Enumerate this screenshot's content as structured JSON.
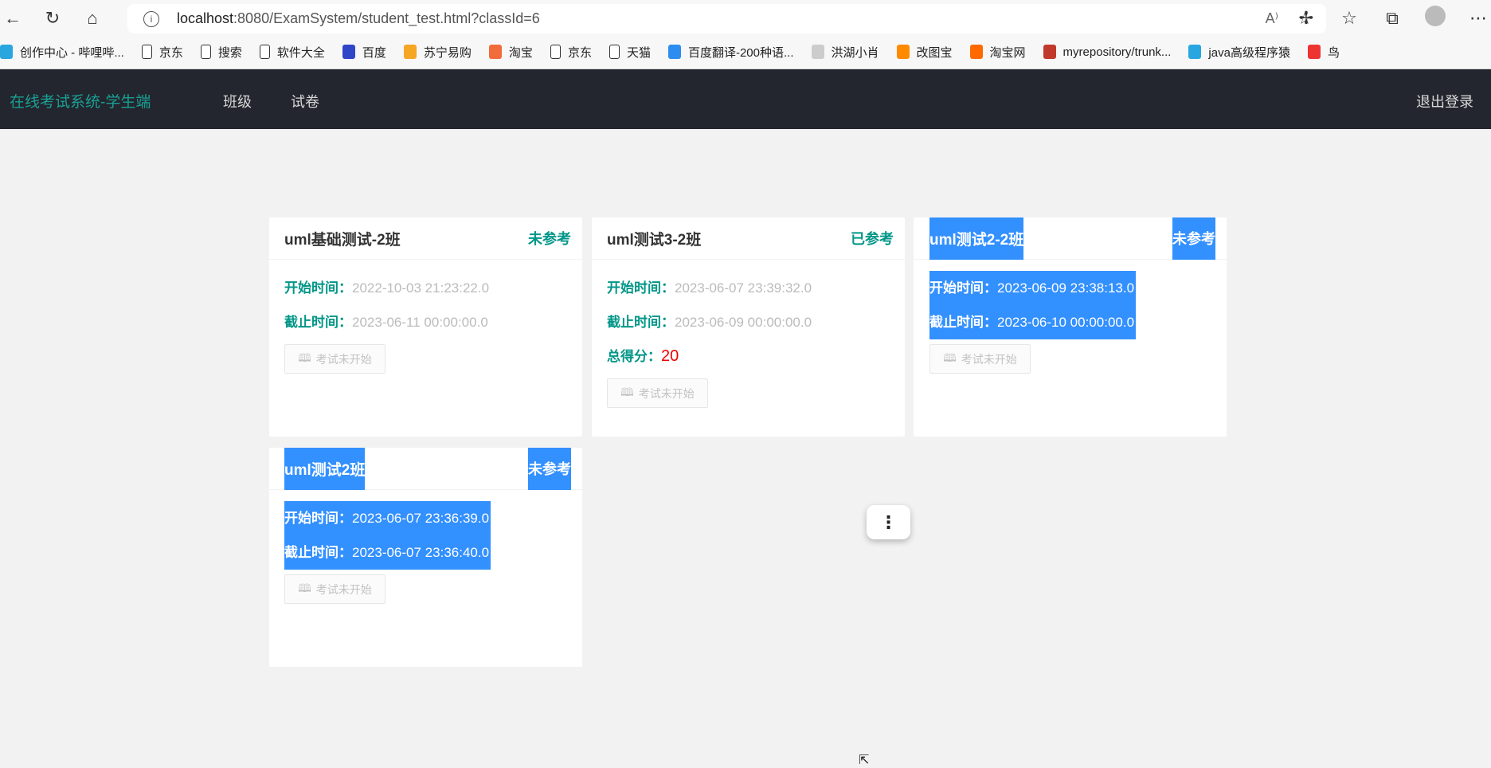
{
  "browser": {
    "url_host": "localhost",
    "url_rest": ":8080/ExamSystem/student_test.html?classId=6",
    "bookmarks": [
      "创作中心 - 哔哩哔...",
      "京东",
      "搜索",
      "软件大全",
      "百度",
      "苏宁易购",
      "淘宝",
      "京东",
      "天猫",
      "百度翻译-200种语...",
      "洪湖小肖",
      "改图宝",
      "淘宝网",
      "myrepository/trunk...",
      "java高级程序猿",
      "鸟"
    ]
  },
  "nav": {
    "brand": "在线考试系统-学生端",
    "items": [
      "班级",
      "试卷"
    ],
    "logout": "退出登录"
  },
  "labels": {
    "start": "开始时间：",
    "end": "截止时间：",
    "score": "总得分：",
    "button": "考试未开始"
  },
  "cards": [
    {
      "title": "uml基础测试-2班",
      "status": "未参考",
      "start": "2022-10-03 21:23:22.0",
      "end": "2023-06-11 00:00:00.0"
    },
    {
      "title": "uml测试3-2班",
      "status": "已参考",
      "start": "2023-06-07 23:39:32.0",
      "end": "2023-06-09 00:00:00.0",
      "score": "20"
    },
    {
      "title": "uml测试2-2班",
      "status": "未参考",
      "start": "2023-06-09 23:38:13.0",
      "end": "2023-06-10 00:00:00.0"
    },
    {
      "title": "uml测试2班",
      "status": "未参考",
      "start": "2023-06-07 23:36:39.0",
      "end": "2023-06-07 23:36:40.0"
    }
  ],
  "colors": {
    "accent": "#009688",
    "nav_bg": "#23262e",
    "selection": "#3390ff",
    "score": "#ee0000"
  }
}
